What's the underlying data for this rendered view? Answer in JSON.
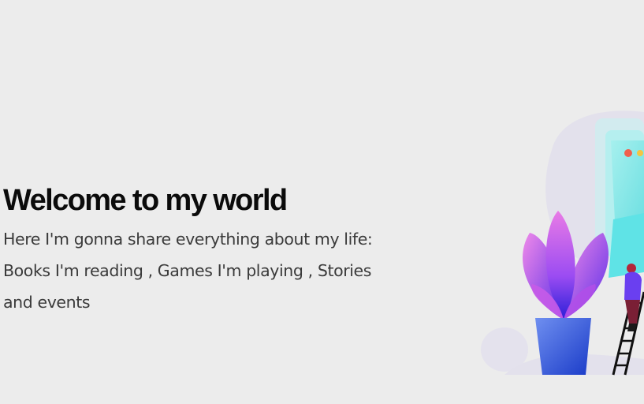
{
  "hero": {
    "title": "Welcome to my world",
    "description": "Here I'm gonna share everything about my life: Books I'm reading , Games I'm playing , Stories and events"
  },
  "illustration": {
    "icon": "plant-monitor-ladder-illustration",
    "colors": {
      "background_blob": "#e3e1ec",
      "screen": "#8fe8e6",
      "leaf_pink": "#e36fe0",
      "leaf_purple": "#7b3bf0",
      "pot_blue": "#3b5fe0",
      "dot_red": "#f0604d",
      "dot_yellow": "#f5c542"
    }
  }
}
